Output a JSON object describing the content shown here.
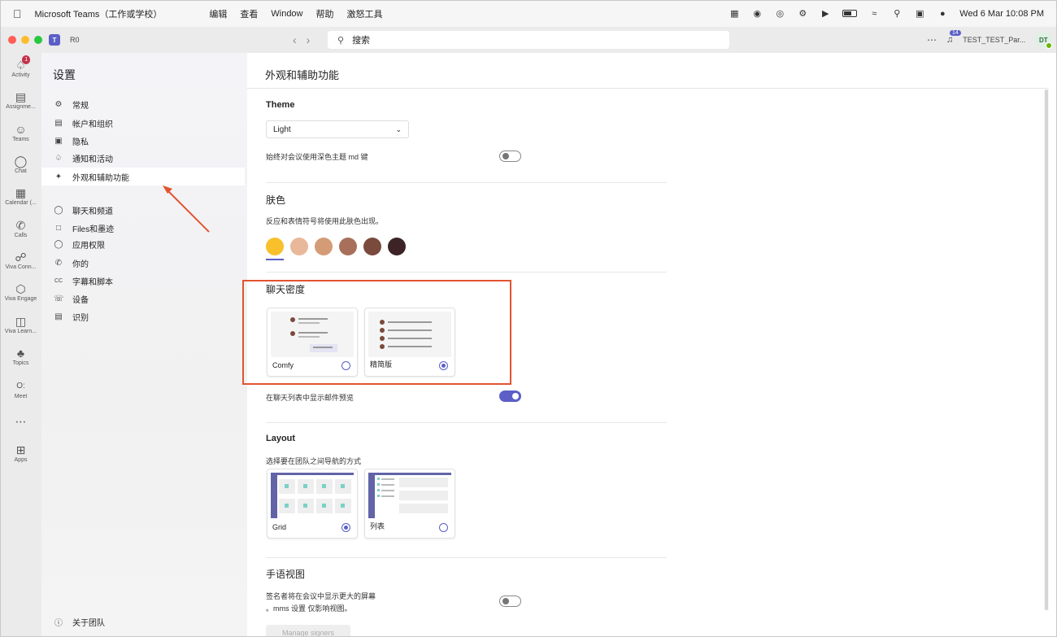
{
  "menubar": {
    "app": "Microsoft Teams（工作或学校）",
    "items": [
      "编辑",
      "查看",
      "Window",
      "帮助",
      "激怒工具"
    ],
    "datetime": "Wed 6 Mar  10:08 PM"
  },
  "titlebar": {
    "account_short": "R0",
    "search_placeholder": "搜索",
    "notification_count": "14",
    "tenant": "TEST_TEST_Par...",
    "avatar": "DT"
  },
  "rail": [
    {
      "label": "Activity",
      "badge": "1"
    },
    {
      "label": "Assignme..."
    },
    {
      "label": "Teams"
    },
    {
      "label": "Chat"
    },
    {
      "label": "Calendar (..."
    },
    {
      "label": "Calls"
    },
    {
      "label": "Viva Conn..."
    },
    {
      "label": "Viva Engage"
    },
    {
      "label": "Viva Learn..."
    },
    {
      "label": "Topics"
    },
    {
      "label": "Meet"
    },
    {
      "label": "Apps"
    }
  ],
  "settings_nav": {
    "title": "设置",
    "items": [
      "常规",
      "帐户和组织",
      "隐私",
      "通知和活动",
      "外观和辅助功能",
      "聊天和频道",
      "Files和墨迹",
      "应用权限",
      "你的",
      "字幕和脚本",
      "设备",
      "识别"
    ],
    "about": "关于团队"
  },
  "main": {
    "title": "外观和辅助功能",
    "theme": {
      "heading": "Theme",
      "selected": "Light",
      "dark_meetings_label": "始终对会议使用深色主题 md 键"
    },
    "skin": {
      "heading": "肤色",
      "desc": "反应和表情符号将使用此肤色出现。",
      "colors": [
        "#f7c02c",
        "#e9b89a",
        "#d49b77",
        "#a8705a",
        "#7a4a3d",
        "#3d2326"
      ]
    },
    "density": {
      "heading": "聊天密度",
      "comfy": "Comfy",
      "compact": "精简版",
      "preview_label": "在聊天列表中显示邮件预览"
    },
    "layout": {
      "heading": "Layout",
      "desc": "选择要在团队之间导航的方式",
      "grid": "Grid",
      "list": "列表"
    },
    "sign": {
      "heading": "手语视图",
      "desc1": "签名者将在会议中显示更大的屏幕",
      "desc2": "。mms 设置 仅影响视图。",
      "button": "Manage signers"
    }
  },
  "colors": {
    "accent": "#5b5fc7",
    "annotation": "#e2542f"
  }
}
